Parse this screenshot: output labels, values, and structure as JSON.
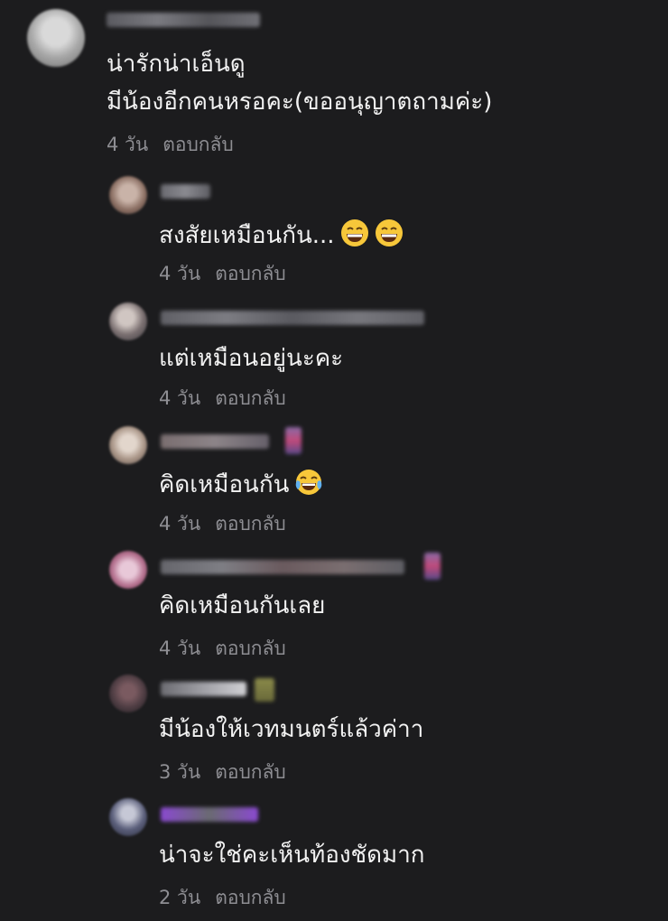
{
  "comments": [
    {
      "text_lines": [
        "น่ารักน่าเอ็นดู",
        "มีน้องอีกคนหรอคะ(ขออนุญาตถามค่ะ)"
      ],
      "time": "4 วัน",
      "reply_label": "ตอบกลับ"
    }
  ],
  "replies": [
    {
      "text": "สงสัยเหมือนกัน...",
      "emojis": [
        "grinning-face-icon",
        "grinning-face-icon"
      ],
      "time": "4 วัน",
      "reply_label": "ตอบกลับ"
    },
    {
      "text": "แต่เหมือนอยู่นะคะ",
      "emojis": [],
      "time": "4 วัน",
      "reply_label": "ตอบกลับ"
    },
    {
      "text": "คิดเหมือนกัน",
      "emojis": [
        "tears-of-joy-icon"
      ],
      "time": "4 วัน",
      "reply_label": "ตอบกลับ"
    },
    {
      "text": "คิดเหมือนกันเลย",
      "emojis": [],
      "time": "4 วัน",
      "reply_label": "ตอบกลับ"
    },
    {
      "text": "มีน้องให้เวทมนตร์แล้วค่าา",
      "emojis": [],
      "time": "3 วัน",
      "reply_label": "ตอบกลับ"
    },
    {
      "text": "น่าจะใช่คะเห็นท้องชัดมาก",
      "emojis": [],
      "time": "2 วัน",
      "reply_label": "ตอบกลับ"
    }
  ],
  "colors": {
    "background": "#1c1c1e",
    "text": "#f2f2f2",
    "meta": "#8e8e93"
  }
}
